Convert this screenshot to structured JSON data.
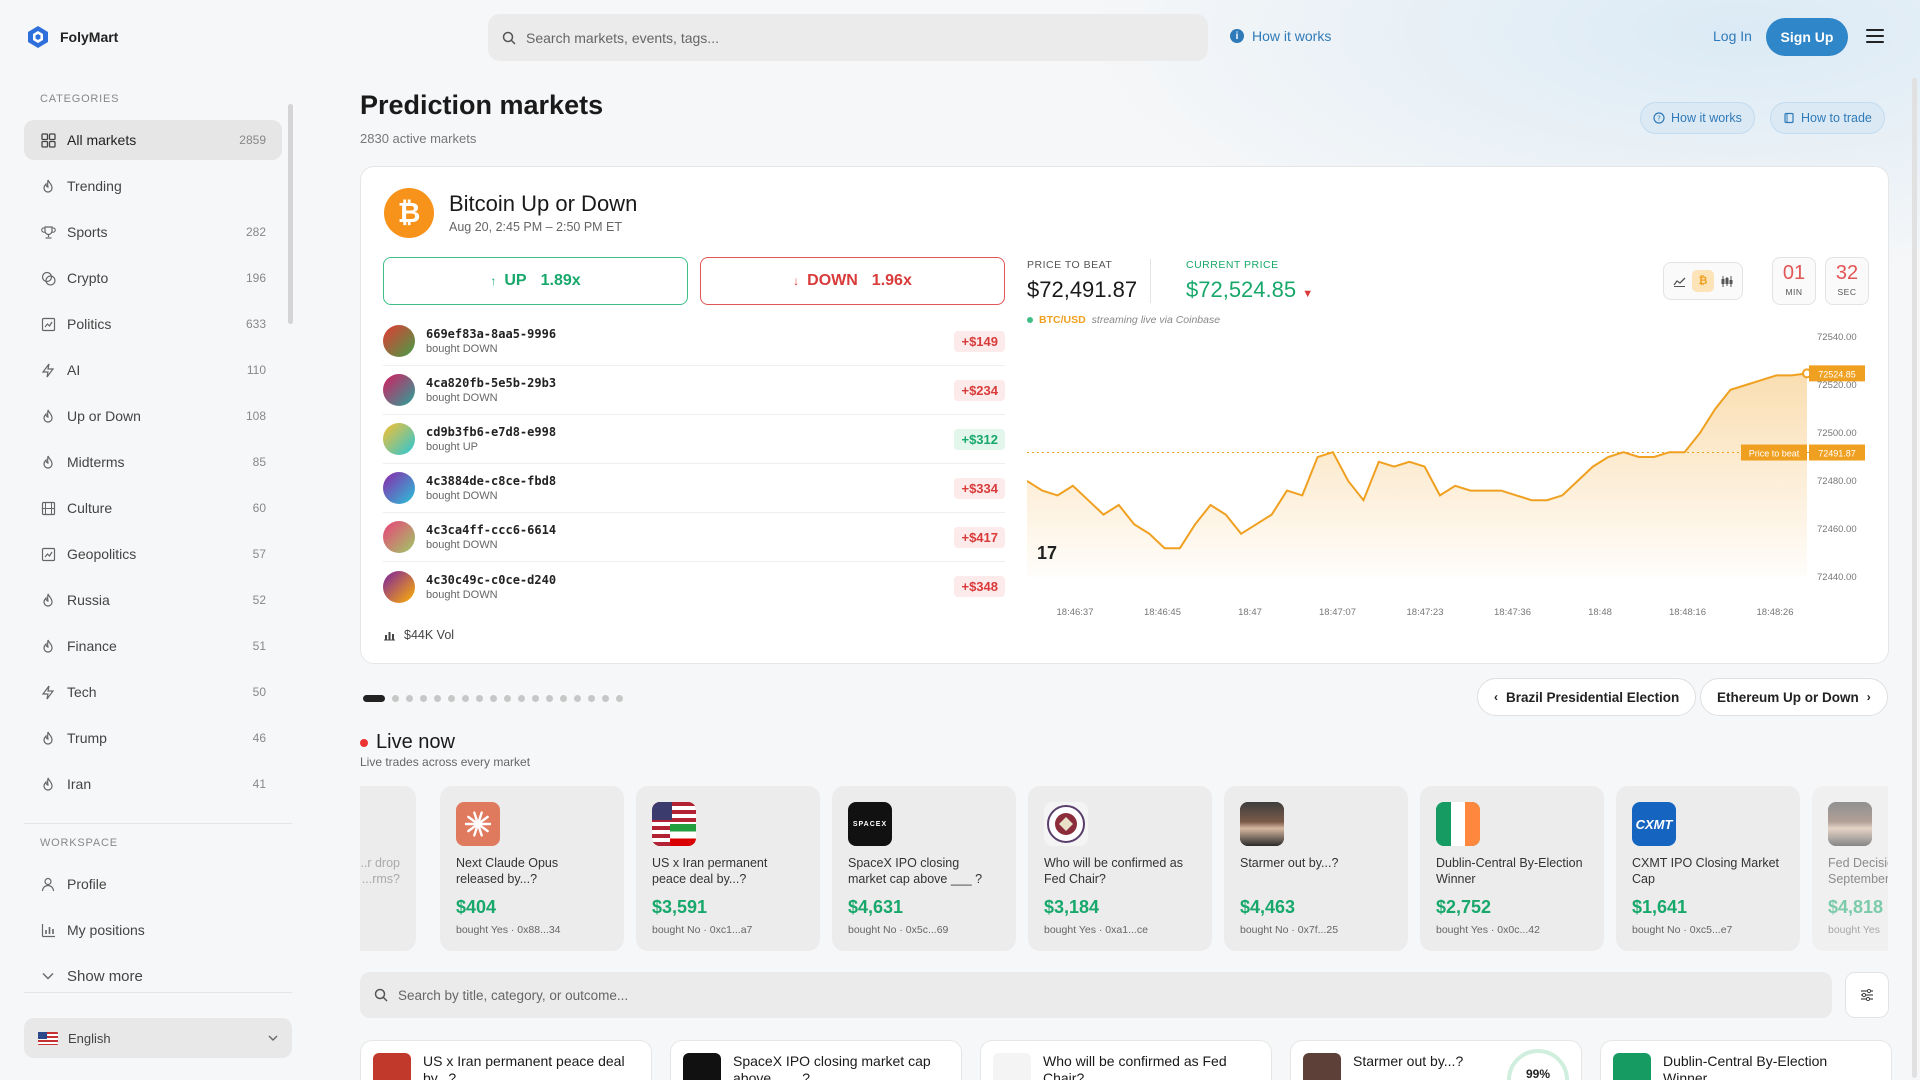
{
  "app": {
    "name": "FolyMart"
  },
  "topbar": {
    "search_placeholder": "Search markets, events, tags...",
    "how_it_works": "How it works",
    "login": "Log In",
    "signup": "Sign Up"
  },
  "sidebar": {
    "categories_label": "CATEGORIES",
    "items": [
      {
        "label": "All markets",
        "count": "2859",
        "icon": "grid-icon"
      },
      {
        "label": "Trending",
        "count": "",
        "icon": "flame-icon"
      },
      {
        "label": "Sports",
        "count": "282",
        "icon": "trophy-icon"
      },
      {
        "label": "Crypto",
        "count": "196",
        "icon": "coins-icon"
      },
      {
        "label": "Politics",
        "count": "633",
        "icon": "landmark-icon"
      },
      {
        "label": "AI",
        "count": "110",
        "icon": "bolt-icon"
      },
      {
        "label": "Up or Down",
        "count": "108",
        "icon": "flame-icon"
      },
      {
        "label": "Midterms",
        "count": "85",
        "icon": "flame-icon"
      },
      {
        "label": "Culture",
        "count": "60",
        "icon": "film-icon"
      },
      {
        "label": "Geopolitics",
        "count": "57",
        "icon": "landmark-icon"
      },
      {
        "label": "Russia",
        "count": "52",
        "icon": "flame-icon"
      },
      {
        "label": "Finance",
        "count": "51",
        "icon": "flame-icon"
      },
      {
        "label": "Tech",
        "count": "50",
        "icon": "bolt-icon"
      },
      {
        "label": "Trump",
        "count": "46",
        "icon": "flame-icon"
      },
      {
        "label": "Iran",
        "count": "41",
        "icon": "flame-icon"
      }
    ],
    "workspace_label": "WORKSPACE",
    "workspace": [
      {
        "label": "Profile",
        "icon": "user-icon"
      },
      {
        "label": "My positions",
        "icon": "bar-chart-icon"
      },
      {
        "label": "Show more",
        "icon": "chevron-down-icon"
      }
    ],
    "language": "English"
  },
  "page": {
    "title": "Prediction markets",
    "subtitle": "2830 active markets",
    "how_it_works": "How it works",
    "how_to_trade": "How to trade"
  },
  "feature": {
    "title": "Bitcoin Up or Down",
    "time": "Aug 20, 2:45 PM – 2:50 PM ET",
    "up_label": "UP",
    "up_odds": "1.89x",
    "down_label": "DOWN",
    "down_odds": "1.96x",
    "trades": [
      {
        "id": "669ef83a-8aa5-9996",
        "action": "bought DOWN",
        "amount": "+$149",
        "side": "neg",
        "grad": [
          "#e53935",
          "#43a047"
        ]
      },
      {
        "id": "4ca820fb-5e5b-29b3",
        "action": "bought DOWN",
        "amount": "+$234",
        "side": "neg",
        "grad": [
          "#d81b60",
          "#26a69a"
        ]
      },
      {
        "id": "cd9b3fb6-e7d8-e998",
        "action": "bought UP",
        "amount": "+$312",
        "side": "pos",
        "grad": [
          "#fbc02d",
          "#26c6da"
        ]
      },
      {
        "id": "4c3884de-c8ce-fbd8",
        "action": "bought DOWN",
        "amount": "+$334",
        "side": "neg",
        "grad": [
          "#8e24aa",
          "#26c6da"
        ]
      },
      {
        "id": "4c3ca4ff-ccc6-6614",
        "action": "bought DOWN",
        "amount": "+$417",
        "side": "neg",
        "grad": [
          "#ec407a",
          "#9ccc65"
        ]
      },
      {
        "id": "4c30c49c-c0ce-d240",
        "action": "bought DOWN",
        "amount": "+$348",
        "side": "neg",
        "grad": [
          "#7b1fa2",
          "#ffb300"
        ]
      }
    ],
    "volume": "$44K Vol",
    "price_to_beat_label": "PRICE TO BEAT",
    "price_to_beat": "$72,491.87",
    "current_price_label": "CURRENT PRICE",
    "current_price": "$72,524.85",
    "feed_pair": "BTC/USD",
    "feed_note": "streaming live via Coinbase",
    "timer_min": "01",
    "timer_min_label": "MIN",
    "timer_sec": "32",
    "timer_sec_label": "SEC",
    "chart_data": {
      "type": "line",
      "x": [
        "18:46:37",
        "18:46:45",
        "18:47",
        "18:47:07",
        "18:47:23",
        "18:47:36",
        "18:48",
        "18:48:16",
        "18:48:26"
      ],
      "y_ticks": [
        "72540.00",
        "72520.00",
        "72500.00",
        "72480.00",
        "72460.00",
        "72440.00"
      ],
      "ylim": [
        72440,
        72540
      ],
      "series": [
        {
          "values": [
            72480,
            72476,
            72474,
            72478,
            72472,
            72466,
            72470,
            72462,
            72458,
            72452,
            72452,
            72462,
            72470,
            72466,
            72458,
            72462,
            72466,
            72476,
            72474,
            72490,
            72492,
            72480,
            72472,
            72488,
            72486,
            72488,
            72486,
            72474,
            72478,
            72476,
            72476,
            72476,
            72474,
            72472,
            72472,
            72474,
            72480,
            72486,
            72490,
            72492,
            72490,
            72490,
            72492,
            72492,
            72500,
            72510,
            72518,
            72520,
            72522,
            72524,
            72524,
            72524.85
          ]
        }
      ],
      "price_to_beat": 72491.87,
      "price_to_beat_tag": "Price to beat",
      "price_to_beat_value": "72491.87",
      "current_tag": "72524.85",
      "color": "#f0a020"
    }
  },
  "carousel": {
    "dot_count": 18,
    "active_index": 0,
    "prev": "Brazil Presidential Election",
    "next": "Ethereum Up or Down"
  },
  "live": {
    "title": "Live now",
    "subtitle": "Live trades across every market",
    "partial_left": "...r drop\n...rms?",
    "cards": [
      {
        "title": "Next Claude Opus released by...?",
        "amount": "$404",
        "meta": "bought Yes · 0x88...34",
        "img": "claude-logo",
        "color": "#e07a5f"
      },
      {
        "title": "US x Iran permanent peace deal by...?",
        "amount": "$3,591",
        "meta": "bought No · 0xc1...a7",
        "img": "flags",
        "color": "#c0392b"
      },
      {
        "title": "SpaceX IPO closing market cap above ___ ?",
        "amount": "$4,631",
        "meta": "bought No · 0x5c...69",
        "img": "spacex-logo",
        "color": "#111111"
      },
      {
        "title": "Who will be confirmed as Fed Chair?",
        "amount": "$3,184",
        "meta": "bought Yes · 0xa1...ce",
        "img": "fed-seal",
        "color": "#f4f4f4"
      },
      {
        "title": "Starmer out by...?",
        "amount": "$4,463",
        "meta": "bought No · 0x7f...25",
        "img": "portrait",
        "color": "#5d4037"
      },
      {
        "title": "Dublin-Central By-Election Winner",
        "amount": "$2,752",
        "meta": "bought Yes · 0x0c...42",
        "img": "irish-flag",
        "color": "#169b62"
      },
      {
        "title": "CXMT IPO Closing Market Cap",
        "amount": "$1,641",
        "meta": "bought No · 0xc5...e7",
        "img": "cxmt-logo",
        "color": "#1565c0"
      },
      {
        "title": "Fed Decision in September?",
        "amount": "$4,818",
        "meta": "bought Yes",
        "img": "portrait",
        "color": "#6d6d6d"
      }
    ],
    "spacex_text": "SPACEX",
    "cxmt_text": "CXMT"
  },
  "market_search": {
    "placeholder": "Search by title, category, or outcome..."
  },
  "market_cards": [
    {
      "title": "US x Iran permanent peace deal by...?",
      "color": "#c0392b"
    },
    {
      "title": "SpaceX IPO closing market cap above ___ ?",
      "color": "#111111"
    },
    {
      "title": "Who will be confirmed as Fed Chair?",
      "color": "#f4f4f4"
    },
    {
      "title": "Starmer out by...?",
      "color": "#5d4037",
      "pct": "99%"
    },
    {
      "title": "Dublin-Central By-Election Winner",
      "color": "#169b62"
    }
  ]
}
